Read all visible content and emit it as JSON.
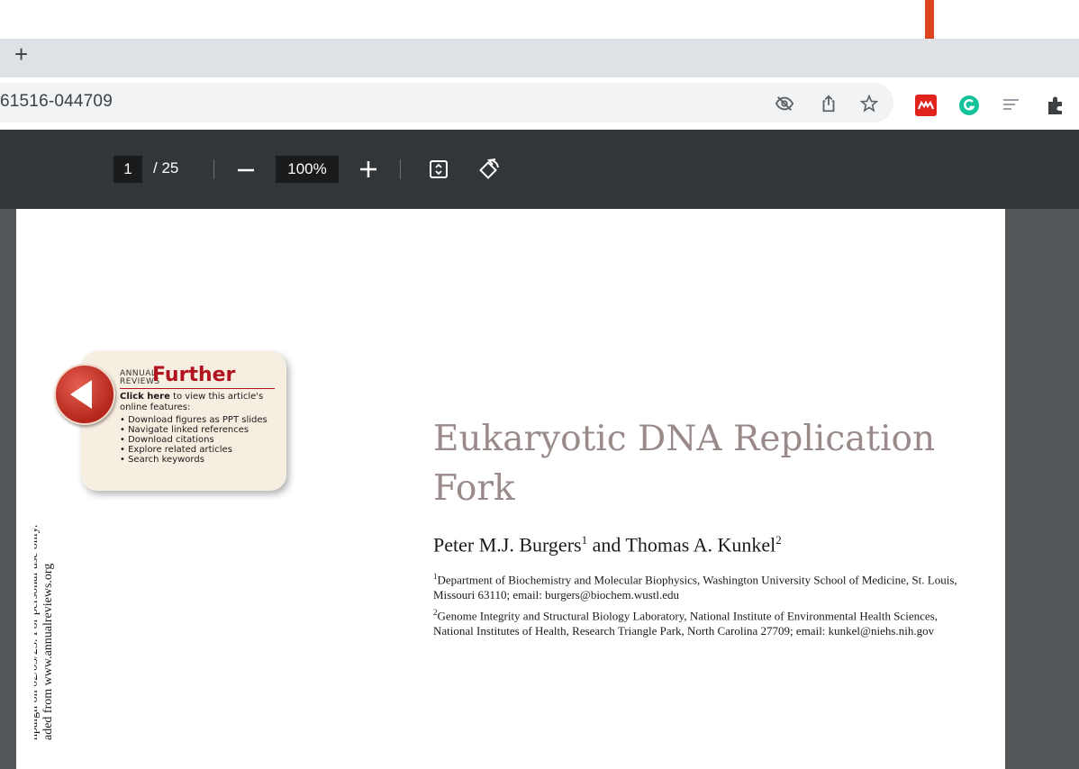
{
  "browser": {
    "new_tab_label": "+",
    "url": "61516-044709",
    "accent_arrow_color": "#d9441e",
    "icons": [
      "eye-off-icon",
      "share-icon",
      "star-icon",
      "mendeley-icon",
      "grammarly-icon",
      "reading-list-icon",
      "puzzle-icon"
    ]
  },
  "pdf_toolbar": {
    "current_page": "1",
    "page_total": "/ 25",
    "zoom": "100%",
    "zoom_out_label": "—",
    "zoom_in_label": "+"
  },
  "further_card": {
    "annual_reviews": "ANNUAL REVIEWS",
    "heading": "Further",
    "click_here": "Click here",
    "intro": "to view this article's online features:",
    "bullets": [
      "Download figures as PPT slides",
      "Navigate linked references",
      "Download citations",
      "Explore related articles",
      "Search keywords"
    ]
  },
  "article": {
    "title": "Eukaryotic DNA Replication Fork",
    "author1": "Peter M.J. Burgers",
    "author1_sup": "1",
    "and": "and Thomas A. Kunkel",
    "author2_sup": "2",
    "aff1_sup": "1",
    "aff1": "Department of Biochemistry and Molecular Biophysics, Washington University School of Medicine, St. Louis, Missouri 63110; email: burgers@biochem.wustl.edu",
    "aff2_sup": "2",
    "aff2": "Genome Integrity and Structural Biology Laboratory, National Institute of Environmental Health Sciences, National Institutes of Health, Research Triangle Park, North Carolina 27709; email: kunkel@niehs.nih.gov",
    "side_line1": "aded from www.annualreviews.org",
    "side_line2": "npaign on 02/03/23. For personal use only."
  }
}
